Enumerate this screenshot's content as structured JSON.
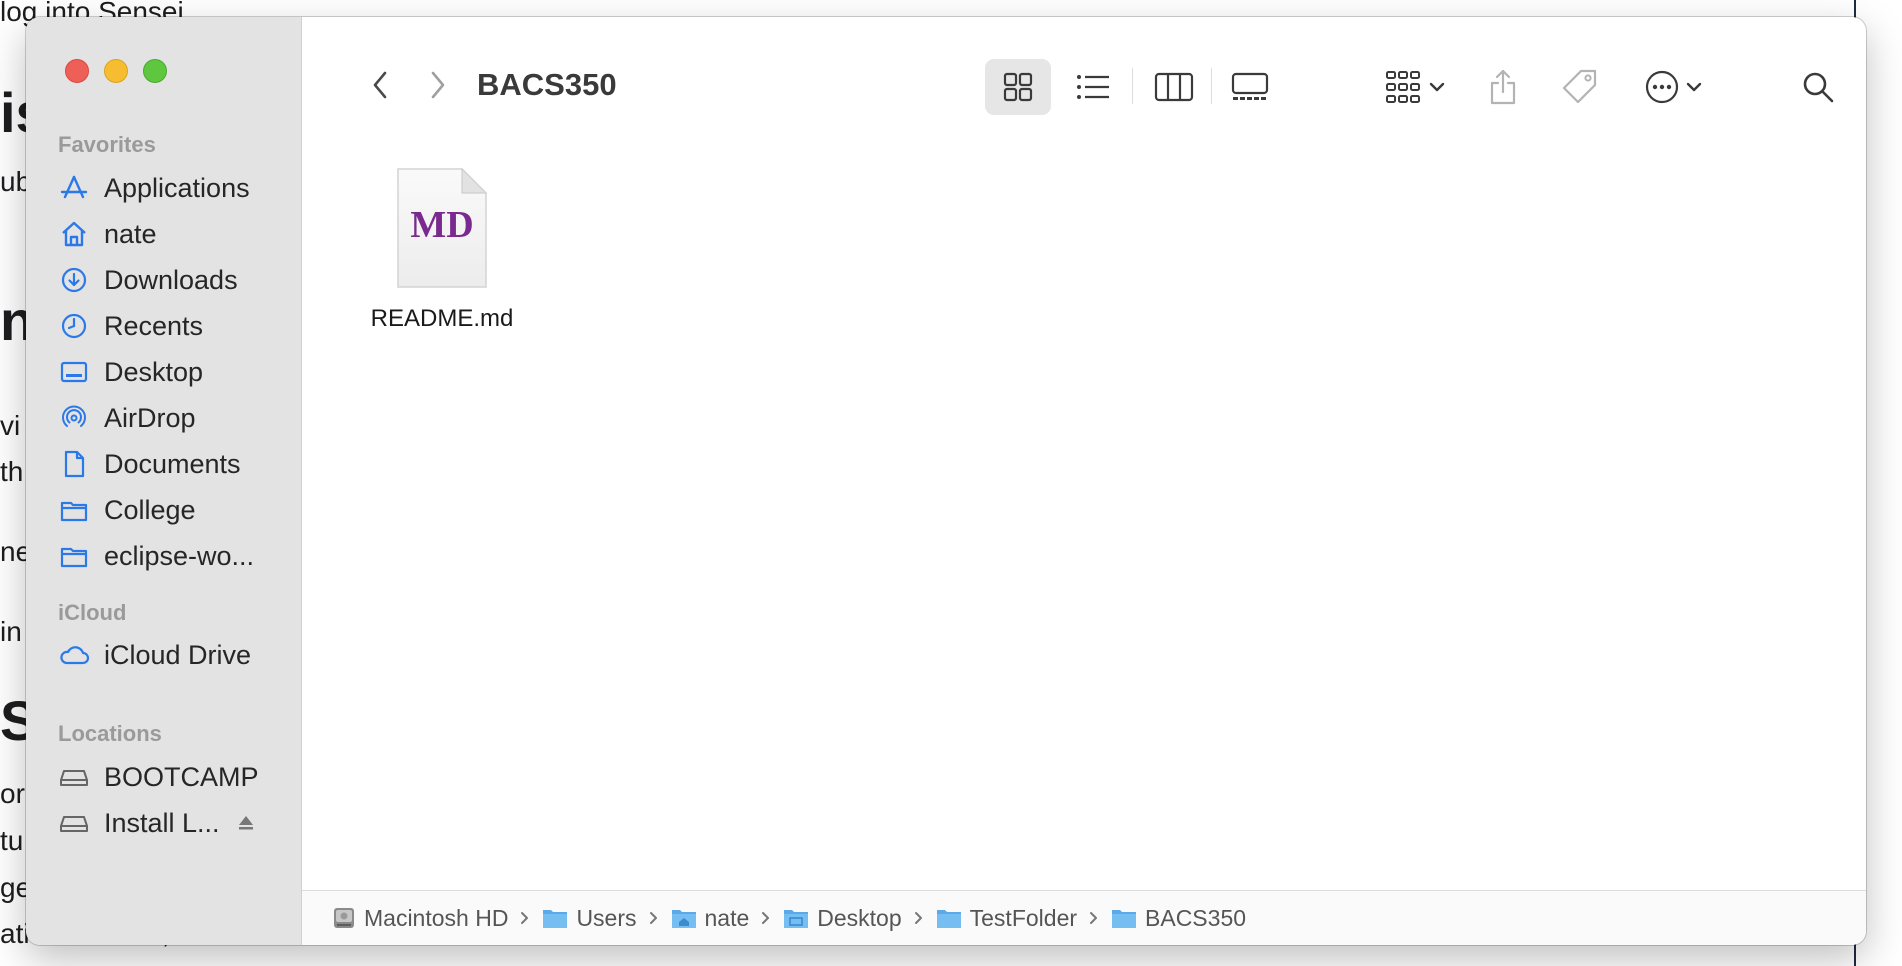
{
  "window": {
    "title": "BACS350"
  },
  "background_doc": {
    "fragments": [
      "log into Sensei",
      "is",
      "ub",
      "ne",
      "vi",
      "th",
      "ne",
      "in",
      "S",
      "or",
      "tu",
      "ge",
      "ation matters, so use all lower case"
    ]
  },
  "sidebar": {
    "favorites_header": "Favorites",
    "favorites": [
      {
        "label": "Applications",
        "icon": "applications-icon"
      },
      {
        "label": "nate",
        "icon": "home-icon"
      },
      {
        "label": "Downloads",
        "icon": "downloads-icon"
      },
      {
        "label": "Recents",
        "icon": "clock-icon"
      },
      {
        "label": "Desktop",
        "icon": "desktop-icon"
      },
      {
        "label": "AirDrop",
        "icon": "airdrop-icon"
      },
      {
        "label": "Documents",
        "icon": "document-icon"
      },
      {
        "label": "College",
        "icon": "folder-icon"
      },
      {
        "label": "eclipse-wo...",
        "icon": "folder-icon"
      }
    ],
    "icloud_header": "iCloud",
    "icloud": [
      {
        "label": "iCloud Drive",
        "icon": "cloud-icon"
      }
    ],
    "locations_header": "Locations",
    "locations": [
      {
        "label": "BOOTCAMP",
        "icon": "drive-icon"
      },
      {
        "label": "Install L...",
        "icon": "drive-icon"
      }
    ]
  },
  "files": [
    {
      "name": "README.md",
      "icon_text": "MD"
    }
  ],
  "pathbar": {
    "items": [
      "Macintosh HD",
      "Users",
      "nate",
      "Desktop",
      "TestFolder",
      "BACS350"
    ]
  },
  "colors": {
    "accent": "#2b79e8",
    "md_purple": "#7a2a8f",
    "sidebar_bg": "#e3e3e3"
  }
}
